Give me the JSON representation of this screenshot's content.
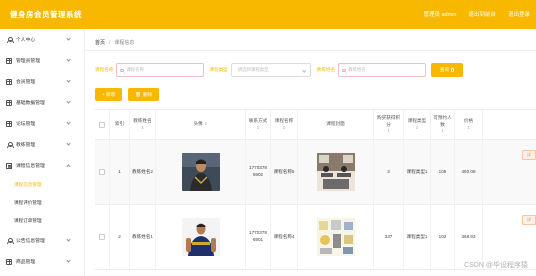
{
  "app": {
    "title": "健身房会员管理系统"
  },
  "header": {
    "links": [
      "管理员 admin",
      "退出到前台",
      "退出登录"
    ]
  },
  "sidebar": {
    "items": [
      {
        "label": "个人中心",
        "icon": "user-icon"
      },
      {
        "label": "管理员管理",
        "icon": "grid-icon"
      },
      {
        "label": "会员管理",
        "icon": "grid-icon"
      },
      {
        "label": "基础数据管理",
        "icon": "grid-icon"
      },
      {
        "label": "论坛管理",
        "icon": "grid-icon"
      },
      {
        "label": "教练管理",
        "icon": "user-icon"
      },
      {
        "label": "课程信息管理",
        "icon": "doc-icon",
        "expanded": true
      }
    ],
    "subitems": [
      "课程信息管理",
      "课程评价管理",
      "课程订单管理"
    ],
    "items_after": [
      {
        "label": "公告信息管理",
        "icon": "user-icon"
      },
      {
        "label": "商品管理",
        "icon": "grid-icon"
      }
    ]
  },
  "breadcrumb": {
    "home": "首页",
    "separator": "/",
    "current": "课程信息"
  },
  "search": {
    "fields": [
      {
        "label": "课程名称",
        "placeholder": "课程名称"
      },
      {
        "label": "课程类型",
        "placeholder": "请选择课程类型"
      },
      {
        "label": "教练姓名",
        "placeholder": "教练姓名"
      }
    ],
    "button": "查询"
  },
  "actions": {
    "add": "+ 新增",
    "delete": "删除"
  },
  "table": {
    "headers": [
      "索引",
      "教练姓名",
      "头像",
      "联系方式",
      "课程名称",
      "课程封面",
      "购买获得积分",
      "课程类型",
      "可预约人数",
      "价格"
    ],
    "sort_mark": "⇕",
    "rows": [
      {
        "idx": "1",
        "coach": "教练姓名2",
        "phone": "17703786902",
        "course": "课程名称5",
        "points": "3",
        "type": "课程类型1",
        "capacity": "105",
        "price": "460.08"
      },
      {
        "idx": "2",
        "coach": "教练姓名1",
        "phone": "17703786901",
        "course": "课程名称4",
        "points": "337",
        "type": "课程类型1",
        "capacity": "102",
        "price": "368.93"
      }
    ],
    "op_glyph": "详"
  },
  "watermark": "CSDN @毕设程序猿",
  "colors": {
    "accent": "#f8b800",
    "sidebar_active": "#f8b800"
  }
}
